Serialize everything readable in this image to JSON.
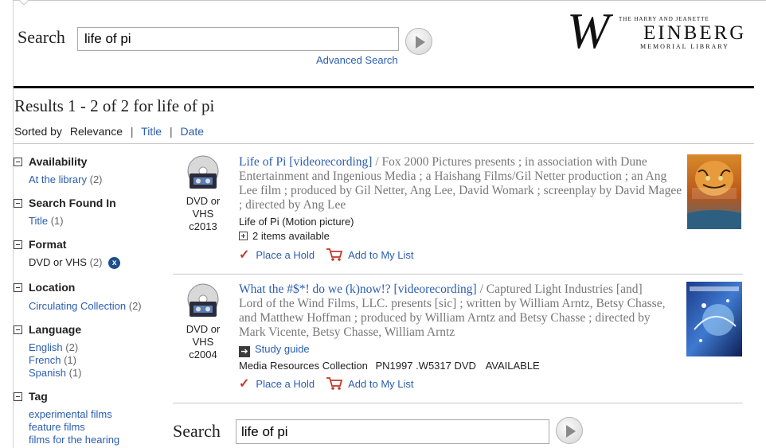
{
  "header": {
    "search_label": "Search",
    "search_value": "life of pi",
    "advanced_search": "Advanced Search"
  },
  "logo": {
    "letter": "W",
    "top_line": "THE HARRY AND JEANETTE",
    "main": "EINBERG",
    "sub": "MEMORIAL LIBRARY"
  },
  "results": {
    "heading": "Results 1 - 2 of 2 for life of pi",
    "sorted_by": "Sorted by",
    "sort_relevance": "Relevance",
    "sort_separator": "|",
    "sort_title": "Title",
    "sort_date": "Date"
  },
  "facets": {
    "availability": {
      "heading": "Availability",
      "items": [
        {
          "label": "At the library",
          "count": "(2)"
        }
      ]
    },
    "search_found_in": {
      "heading": "Search Found In",
      "items": [
        {
          "label": "Title",
          "count": "(1)"
        }
      ]
    },
    "format": {
      "heading": "Format",
      "items": [
        {
          "label": "DVD or VHS",
          "count": "(2)",
          "remove": "x"
        }
      ]
    },
    "location": {
      "heading": "Location",
      "items": [
        {
          "label": "Circulating Collection",
          "count": "(2)"
        }
      ]
    },
    "language": {
      "heading": "Language",
      "items": [
        {
          "label": "English",
          "count": "(2)"
        },
        {
          "label": "French",
          "count": "(1)"
        },
        {
          "label": "Spanish",
          "count": "(1)"
        }
      ]
    },
    "tag": {
      "heading": "Tag",
      "items": [
        {
          "label": "experimental films"
        },
        {
          "label": "feature films"
        },
        {
          "label": "films for the hearing"
        }
      ]
    }
  },
  "items": [
    {
      "format_line1": "DVD or",
      "format_line2": "VHS",
      "year": "c2013",
      "title_link": "Life of Pi [videorecording]",
      "title_rest": " / Fox 2000 Pictures presents ; in association with Dune Entertainment and Ingenious Media ; a Haishang Films/Gil Netter production ; an Ang Lee film ; produced by Gil Netter, Ang Lee, David Womark ; screenplay by David Magee ; directed by Ang Lee",
      "subject": "Life of Pi (Motion picture)",
      "availability": "2 items available",
      "place_hold": "Place a Hold",
      "add_list": "Add to My List"
    },
    {
      "format_line1": "DVD or",
      "format_line2": "VHS",
      "year": "c2004",
      "title_link": "What the #$*! do we (k)now!? [videorecording]",
      "title_rest": " / Captured Light Industries [and] Lord of the Wind Films, LLC. presents [sic] ; written by William Arntz, Betsy Chasse, and Matthew Hoffman ; produced by William Arntz and Betsy Chasse ; directed by Mark Vicente, Betsy Chasse, William Arntz",
      "study_guide": "Study guide",
      "holding_collection": "Media Resources Collection",
      "call_number": "PN1997 .W5317 DVD",
      "status": "AVAILABLE",
      "place_hold": "Place a Hold",
      "add_list": "Add to My List"
    }
  ],
  "footer_search": {
    "label": "Search",
    "value": "life of pi"
  },
  "colors": {
    "link": "#2a5db0",
    "rule": "#111111",
    "remove_badge": "#1f4e8c",
    "hold_check": "#c0392b"
  }
}
